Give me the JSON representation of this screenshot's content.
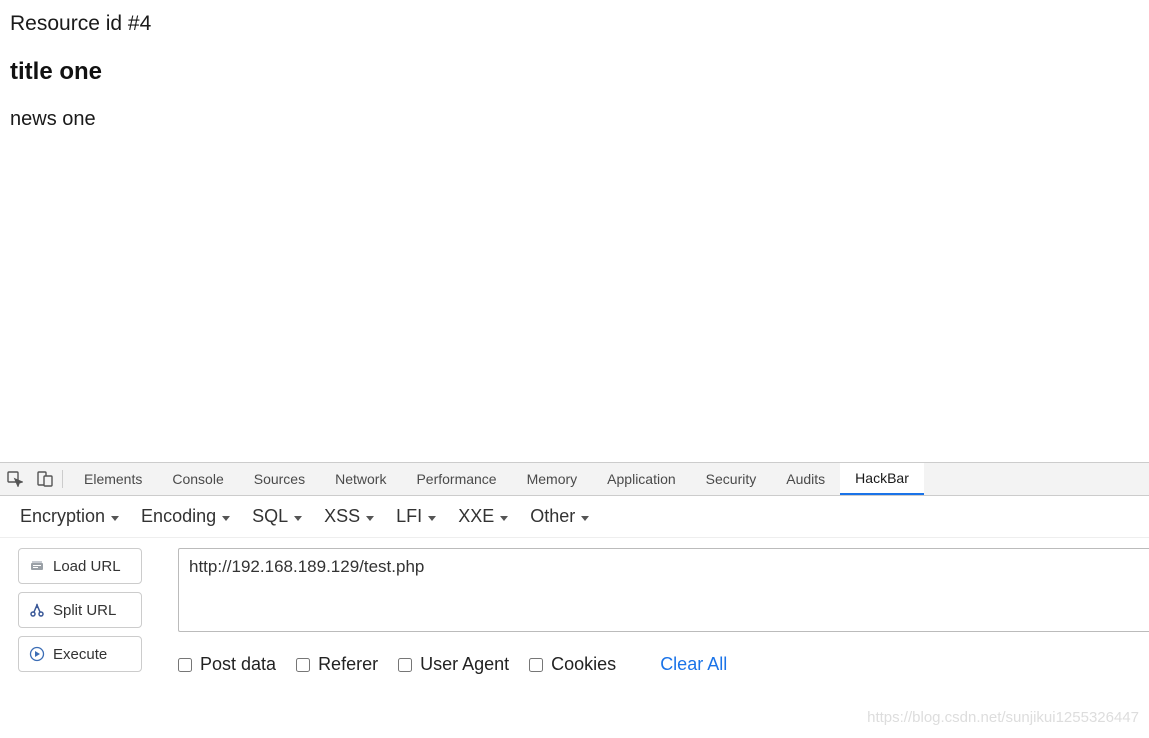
{
  "page": {
    "resource_line": "Resource id #4",
    "title": "title one",
    "news": "news one"
  },
  "devtools": {
    "tabs": [
      "Elements",
      "Console",
      "Sources",
      "Network",
      "Performance",
      "Memory",
      "Application",
      "Security",
      "Audits",
      "HackBar"
    ],
    "active_tab": "HackBar"
  },
  "hackbar": {
    "menus": [
      "Encryption",
      "Encoding",
      "SQL",
      "XSS",
      "LFI",
      "XXE",
      "Other"
    ],
    "buttons": {
      "load_url": "Load URL",
      "split_url": "Split URL",
      "execute": "Execute"
    },
    "url_value": "http://192.168.189.129/test.php",
    "options": {
      "post_data": "Post data",
      "referer": "Referer",
      "user_agent": "User Agent",
      "cookies": "Cookies"
    },
    "clear_all": "Clear All"
  },
  "watermark": "https://blog.csdn.net/sunjikui1255326447"
}
